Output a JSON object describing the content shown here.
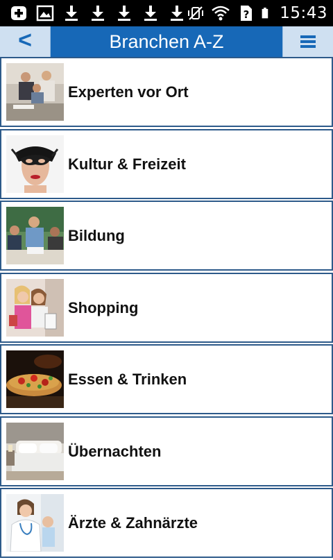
{
  "status_bar": {
    "time": "15:43",
    "icons": [
      "add-box-icon",
      "image-icon",
      "download-icon",
      "download-icon",
      "download-icon",
      "download-icon",
      "download-icon",
      "vibrate-off-icon",
      "wifi-icon",
      "sim-unknown-icon",
      "battery-icon"
    ]
  },
  "header": {
    "back_label": "<",
    "title": "Branchen A-Z",
    "menu_icon": "menu-icon"
  },
  "categories": [
    {
      "label": "Experten vor Ort",
      "image": "business-meeting-photo"
    },
    {
      "label": "Kultur & Freizeit",
      "image": "masquerade-mask-photo"
    },
    {
      "label": "Bildung",
      "image": "classroom-photo"
    },
    {
      "label": "Shopping",
      "image": "shopping-women-photo"
    },
    {
      "label": "Essen & Trinken",
      "image": "pizza-photo"
    },
    {
      "label": "Übernachten",
      "image": "hotel-bed-photo"
    },
    {
      "label": "Ärzte & Zahnärzte",
      "image": "doctor-photo"
    }
  ],
  "colors": {
    "header_bar": "#1768b7",
    "header_buttons": "#cfe0f1",
    "item_border": "#2d5a8a",
    "status_bar": "#000000"
  }
}
